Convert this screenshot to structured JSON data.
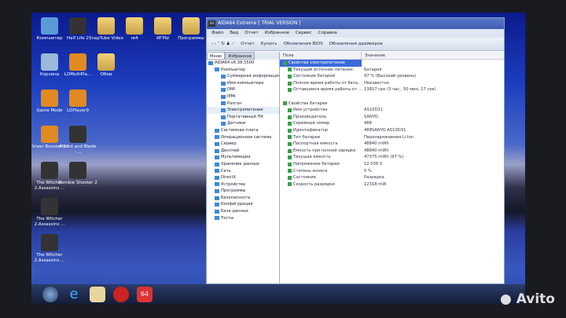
{
  "desktop": {
    "icons": [
      {
        "label": "Компьютер",
        "kind": "computer"
      },
      {
        "label": "Half Life 2",
        "kind": "game"
      },
      {
        "label": "SnapTube Video",
        "kind": "folder"
      },
      {
        "label": "re4",
        "kind": "folder"
      },
      {
        "label": "ИГРЫ",
        "kind": "folder"
      },
      {
        "label": "Программы",
        "kind": "folder"
      },
      {
        "label": "Корзина",
        "kind": "recycle"
      },
      {
        "label": "LDMultiPla...",
        "kind": "app"
      },
      {
        "label": "Обои",
        "kind": "folder"
      },
      {
        "label": "Game Mode",
        "kind": "app"
      },
      {
        "label": "LDPlayer9",
        "kind": "app"
      },
      {
        "label": "Driver Booster 10",
        "kind": "app"
      },
      {
        "label": "Mount and Blade - ...",
        "kind": "game"
      },
      {
        "label": "The Witcher 2.Assassins ...",
        "kind": "game"
      },
      {
        "label": "Zombie Shooter 2",
        "kind": "game"
      },
      {
        "label": "The Witcher 2.Assassins ...",
        "kind": "game"
      },
      {
        "label": "The Witcher 2.Assassins ...",
        "kind": "game"
      }
    ]
  },
  "window": {
    "title": "AIDA64 Extreme [ TRIAL VERSION ]",
    "menu": [
      "Файл",
      "Вид",
      "Отчет",
      "Избранное",
      "Сервис",
      "Справка"
    ],
    "toolbar": [
      "Отчет",
      "Купить",
      "Обновления BIOS",
      "Обновления драйверов"
    ],
    "tabs": [
      "Меню",
      "Избранное"
    ],
    "tree": [
      {
        "label": "AIDA64 v6.38.5500",
        "level": 0
      },
      {
        "label": "Компьютер",
        "level": 1
      },
      {
        "label": "Суммарная информация",
        "level": 2
      },
      {
        "label": "Имя компьютера",
        "level": 2
      },
      {
        "label": "DMI",
        "level": 2
      },
      {
        "label": "IPMI",
        "level": 2
      },
      {
        "label": "Разгон",
        "level": 2
      },
      {
        "label": "Электропитание",
        "level": 2,
        "selected": true
      },
      {
        "label": "Портативный ПК",
        "level": 2
      },
      {
        "label": "Датчики",
        "level": 2
      },
      {
        "label": "Системная плата",
        "level": 1
      },
      {
        "label": "Операционная система",
        "level": 1
      },
      {
        "label": "Сервер",
        "level": 1
      },
      {
        "label": "Дисплей",
        "level": 1
      },
      {
        "label": "Мультимедиа",
        "level": 1
      },
      {
        "label": "Хранение данных",
        "level": 1
      },
      {
        "label": "Сеть",
        "level": 1
      },
      {
        "label": "DirectX",
        "level": 1
      },
      {
        "label": "Устройства",
        "level": 1
      },
      {
        "label": "Программы",
        "level": 1
      },
      {
        "label": "Безопасность",
        "level": 1
      },
      {
        "label": "Конфигурация",
        "level": 1
      },
      {
        "label": "База данных",
        "level": 1
      },
      {
        "label": "Тесты",
        "level": 1
      }
    ],
    "columns": [
      "Поле",
      "Значение"
    ],
    "sections": [
      {
        "title": "Свойства электропитания",
        "rows": [
          [
            "Текущий источник питания",
            "Батарея"
          ],
          [
            "Состояние батарей",
            "97 % (Высокий уровень)"
          ],
          [
            "Полное время работы от бата...",
            "Неизвестно"
          ],
          [
            "Оставшееся время работы от ...",
            "13817 сек (3 час., 50 мин, 17 сек)"
          ]
        ]
      },
      {
        "title": "Свойства батареи",
        "rows": [
          [
            "Имя устройства",
            "AS10D31"
          ],
          [
            "Производитель",
            "SANYO"
          ],
          [
            "Серийный номер",
            "488"
          ],
          [
            "Идентификатор",
            "488SANYO AS10D31"
          ],
          [
            "Тип батареи",
            "Перезаряжаемая Li-Ion"
          ],
          [
            "Паспортная емкость",
            "48840 mWh"
          ],
          [
            "Емкость при полной зарядке",
            "48840 mWh"
          ],
          [
            "Текущая емкость",
            "47375 mWh  (97 %)"
          ],
          [
            "Напряжение батареи",
            "12.036 V"
          ],
          [
            "Степень износа",
            "0 %"
          ],
          [
            "Состояние",
            "Разрядка"
          ],
          [
            "Скорость разрядки",
            "12318 mW"
          ]
        ]
      }
    ]
  },
  "watermark": "Avito"
}
